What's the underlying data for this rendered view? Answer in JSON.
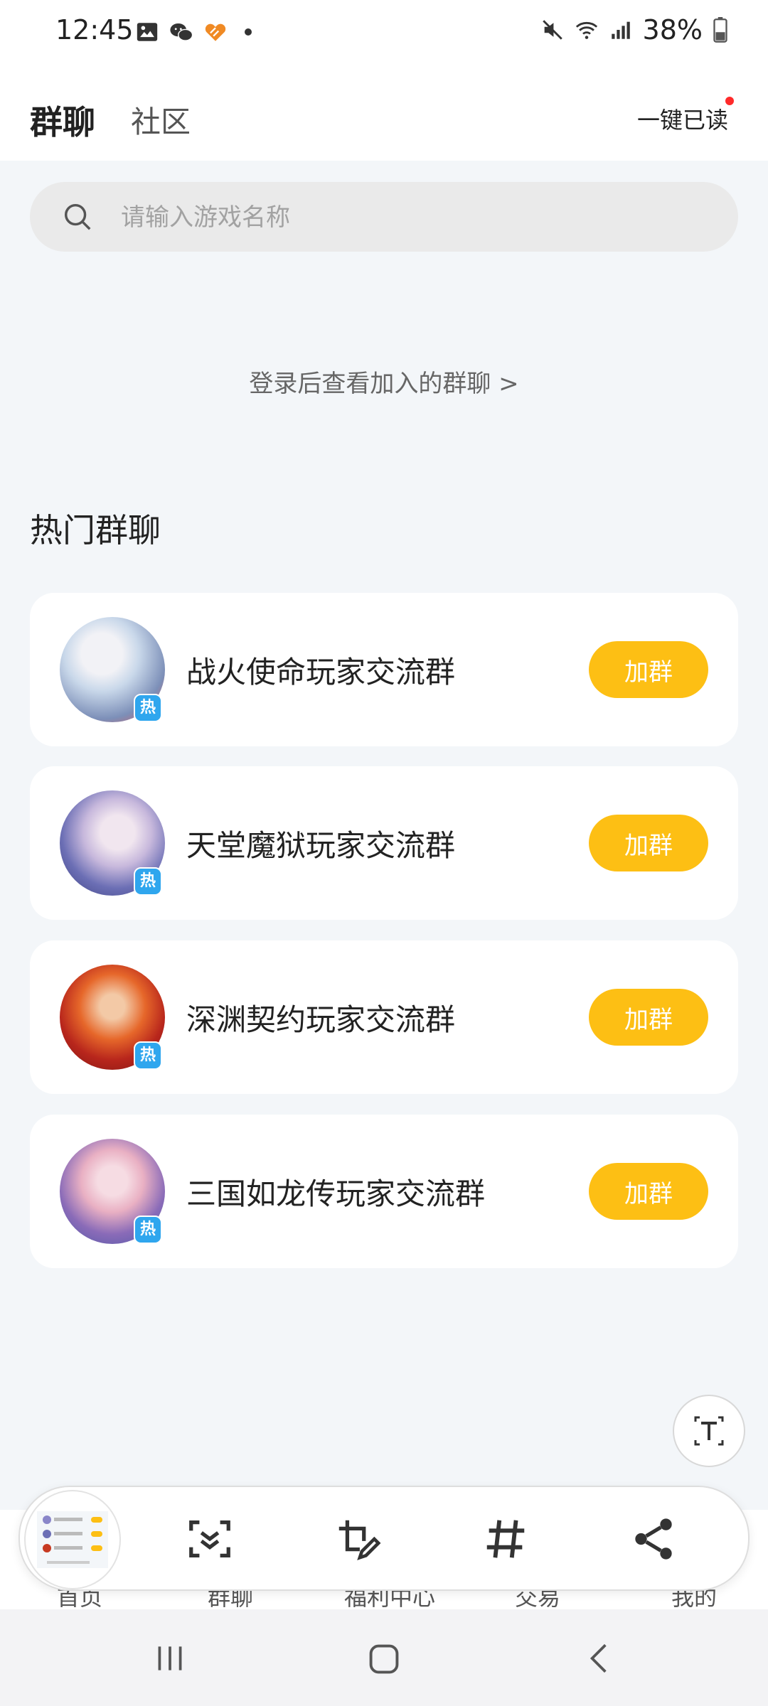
{
  "status_bar": {
    "time": "12:45",
    "battery": "38%",
    "left_icons": [
      "gallery-icon",
      "wechat-icon",
      "app-heart-icon",
      "dot-icon"
    ],
    "right_icons": [
      "mute-icon",
      "wifi-icon",
      "signal-icon",
      "battery-icon"
    ]
  },
  "header": {
    "tabs": [
      {
        "label": "群聊",
        "active": true
      },
      {
        "label": "社区",
        "active": false
      }
    ],
    "mark_all_read": "一键已读"
  },
  "search": {
    "placeholder": "请输入游戏名称"
  },
  "login_prompt": "登录后查看加入的群聊 >",
  "hot_section": {
    "title": "热门群聊",
    "badge": "热",
    "groups": [
      {
        "name": "战火使命玩家交流群",
        "button": "加群",
        "avatar_colors": [
          "#c9d8ea",
          "#e84f4f"
        ]
      },
      {
        "name": "天堂魔狱玩家交流群",
        "button": "加群",
        "avatar_colors": [
          "#3b3f7d",
          "#e6d7ef"
        ]
      },
      {
        "name": "深渊契约玩家交流群",
        "button": "加群",
        "avatar_colors": [
          "#7a1412",
          "#e6672a"
        ]
      },
      {
        "name": "三国如龙传玩家交流群",
        "button": "加群",
        "avatar_colors": [
          "#4b56a6",
          "#e9b0c3"
        ]
      }
    ]
  },
  "bottom_nav": {
    "items": [
      "首页",
      "群聊",
      "福利中心",
      "交易",
      "我的"
    ]
  },
  "toolbar": {
    "icons": [
      "screenshot-thumbnail",
      "scan-icon",
      "edit-crop-icon",
      "hashtag-icon",
      "share-icon"
    ]
  },
  "colors": {
    "accent_yellow": "#fdbf14",
    "badge_blue": "#2fa6ee",
    "background": "#f3f6f9"
  }
}
